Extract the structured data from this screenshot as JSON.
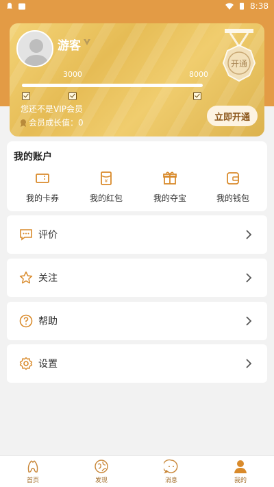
{
  "status_bar": {
    "time": "8:38"
  },
  "vip_card": {
    "username": "游客",
    "progress_start": "3000",
    "progress_end": "8000",
    "progress_fraction": 0.85,
    "not_vip_text": "您还不是VIP会员",
    "growth_text": "会员成长值：0",
    "open_button": "立即开通",
    "medal_text": "开通"
  },
  "account": {
    "title": "我的账户",
    "items": [
      {
        "label": "我的卡券",
        "icon": "ticket-icon"
      },
      {
        "label": "我的红包",
        "icon": "red-envelope-icon"
      },
      {
        "label": "我的夺宝",
        "icon": "gift-icon"
      },
      {
        "label": "我的钱包",
        "icon": "wallet-icon"
      }
    ]
  },
  "menu": [
    {
      "label": "评价",
      "icon": "comment-icon"
    },
    {
      "label": "关注",
      "icon": "star-icon"
    },
    {
      "label": "帮助",
      "icon": "help-icon"
    },
    {
      "label": "设置",
      "icon": "gear-icon"
    }
  ],
  "tabs": [
    {
      "label": "首页",
      "icon": "home-icon"
    },
    {
      "label": "发现",
      "icon": "discover-icon"
    },
    {
      "label": "消息",
      "icon": "message-icon"
    },
    {
      "label": "我的",
      "icon": "profile-icon",
      "active": true
    }
  ],
  "colors": {
    "accent": "#e39b45",
    "gold": "#e6bc55",
    "icon": "#d98a2b"
  }
}
